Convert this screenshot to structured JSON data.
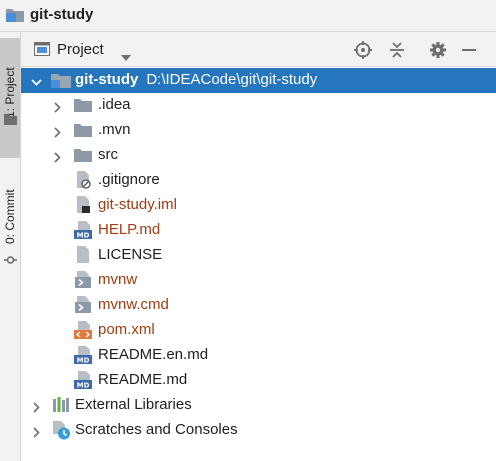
{
  "window": {
    "title": "git-study"
  },
  "side_tabs": {
    "project": "1: Project",
    "commit": "0: Commit"
  },
  "panel": {
    "title": "Project"
  },
  "tree": {
    "root": {
      "name": "git-study",
      "path": "D:\\IDEACode\\git\\git-study"
    },
    "items": [
      {
        "name": ".idea",
        "icon": "folder-icon"
      },
      {
        "name": ".mvn",
        "icon": "folder-icon"
      },
      {
        "name": "src",
        "icon": "folder-icon"
      },
      {
        "name": ".gitignore",
        "icon": "ignore-file-icon"
      },
      {
        "name": "git-study.iml",
        "icon": "module-file-icon"
      },
      {
        "name": "HELP.md",
        "icon": "markdown-file-icon"
      },
      {
        "name": "LICENSE",
        "icon": "text-file-icon"
      },
      {
        "name": "mvnw",
        "icon": "shell-script-icon"
      },
      {
        "name": "mvnw.cmd",
        "icon": "cmd-file-icon"
      },
      {
        "name": "pom.xml",
        "icon": "maven-pom-icon"
      },
      {
        "name": "README.en.md",
        "icon": "markdown-file-icon"
      },
      {
        "name": "README.md",
        "icon": "markdown-file-icon"
      }
    ],
    "external": {
      "name": "External Libraries"
    },
    "scratches": {
      "name": "Scratches and Consoles"
    }
  },
  "colors": {
    "selection": "#2675bf",
    "modified": "#a33c12",
    "folder": "#8c9aa8"
  }
}
